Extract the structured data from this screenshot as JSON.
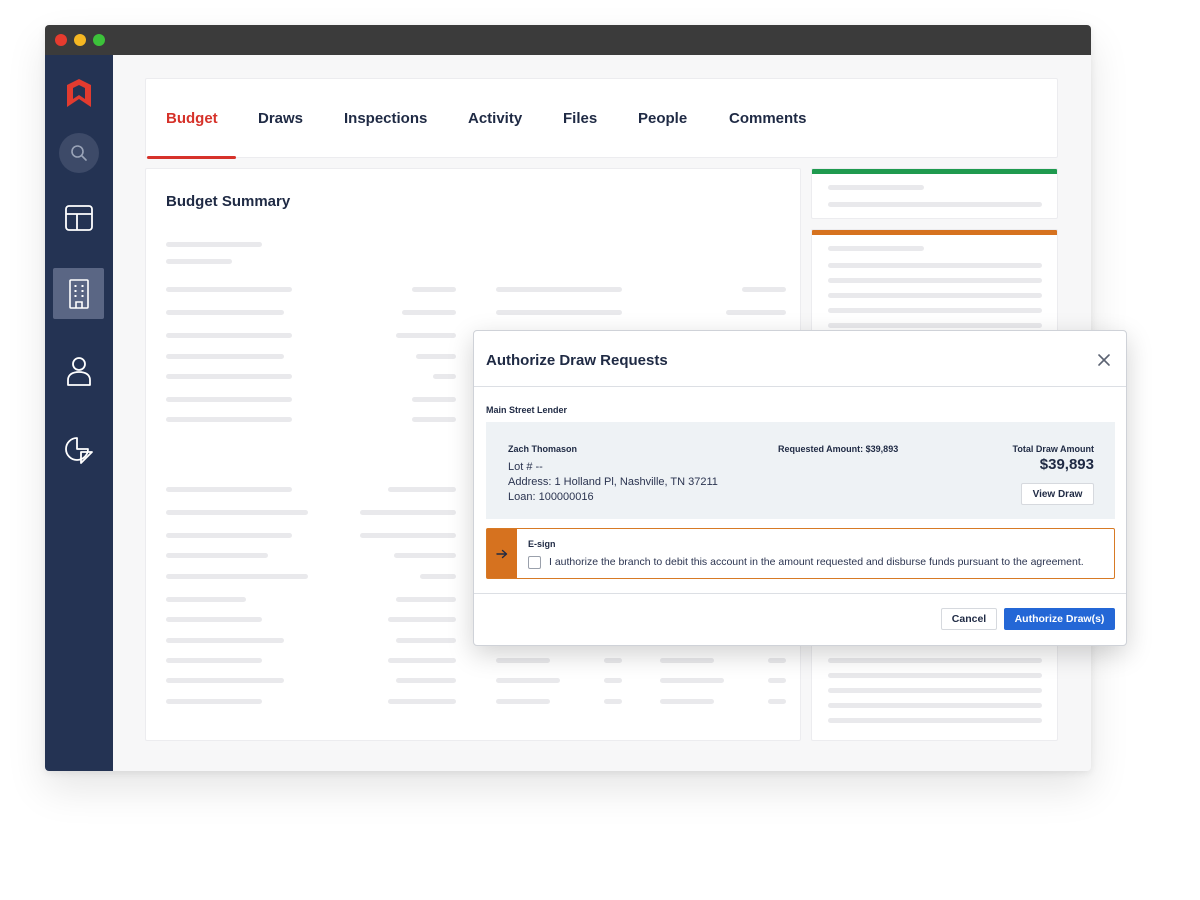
{
  "window": {
    "controls": [
      "close",
      "minimize",
      "maximize"
    ]
  },
  "sidebar": {
    "items": [
      {
        "icon": "logo-icon"
      },
      {
        "icon": "search-icon"
      },
      {
        "icon": "layout-icon"
      },
      {
        "icon": "building-icon",
        "active": true
      },
      {
        "icon": "user-icon"
      },
      {
        "icon": "pie-chart-icon"
      }
    ]
  },
  "tabs": [
    {
      "label": "Budget",
      "active": true
    },
    {
      "label": "Draws"
    },
    {
      "label": "Inspections"
    },
    {
      "label": "Activity"
    },
    {
      "label": "Files"
    },
    {
      "label": "People"
    },
    {
      "label": "Comments"
    }
  ],
  "main": {
    "title": "Budget Summary"
  },
  "modal": {
    "title": "Authorize Draw Requests",
    "lender": "Main Street Lender",
    "borrower": "Zach Thomason",
    "lot": "Lot # --",
    "address": "Address: 1 Holland Pl, Nashville, TN 37211",
    "loan": "Loan: 100000016",
    "requested": "Requested Amount: $39,893",
    "total_label": "Total Draw Amount",
    "total_amount": "$39,893",
    "view_button": "View Draw",
    "esign_label": "E-sign",
    "esign_text": "I authorize the branch to debit this account in the amount requested and disburse funds pursuant to the agreement.",
    "cancel_button": "Cancel",
    "authorize_button": "Authorize Draw(s)"
  },
  "colors": {
    "sidebar": "#243353",
    "accent_red": "#d6322a",
    "status_green": "#1f9a4f",
    "status_orange": "#d6721f",
    "primary_blue": "#2467d6"
  }
}
